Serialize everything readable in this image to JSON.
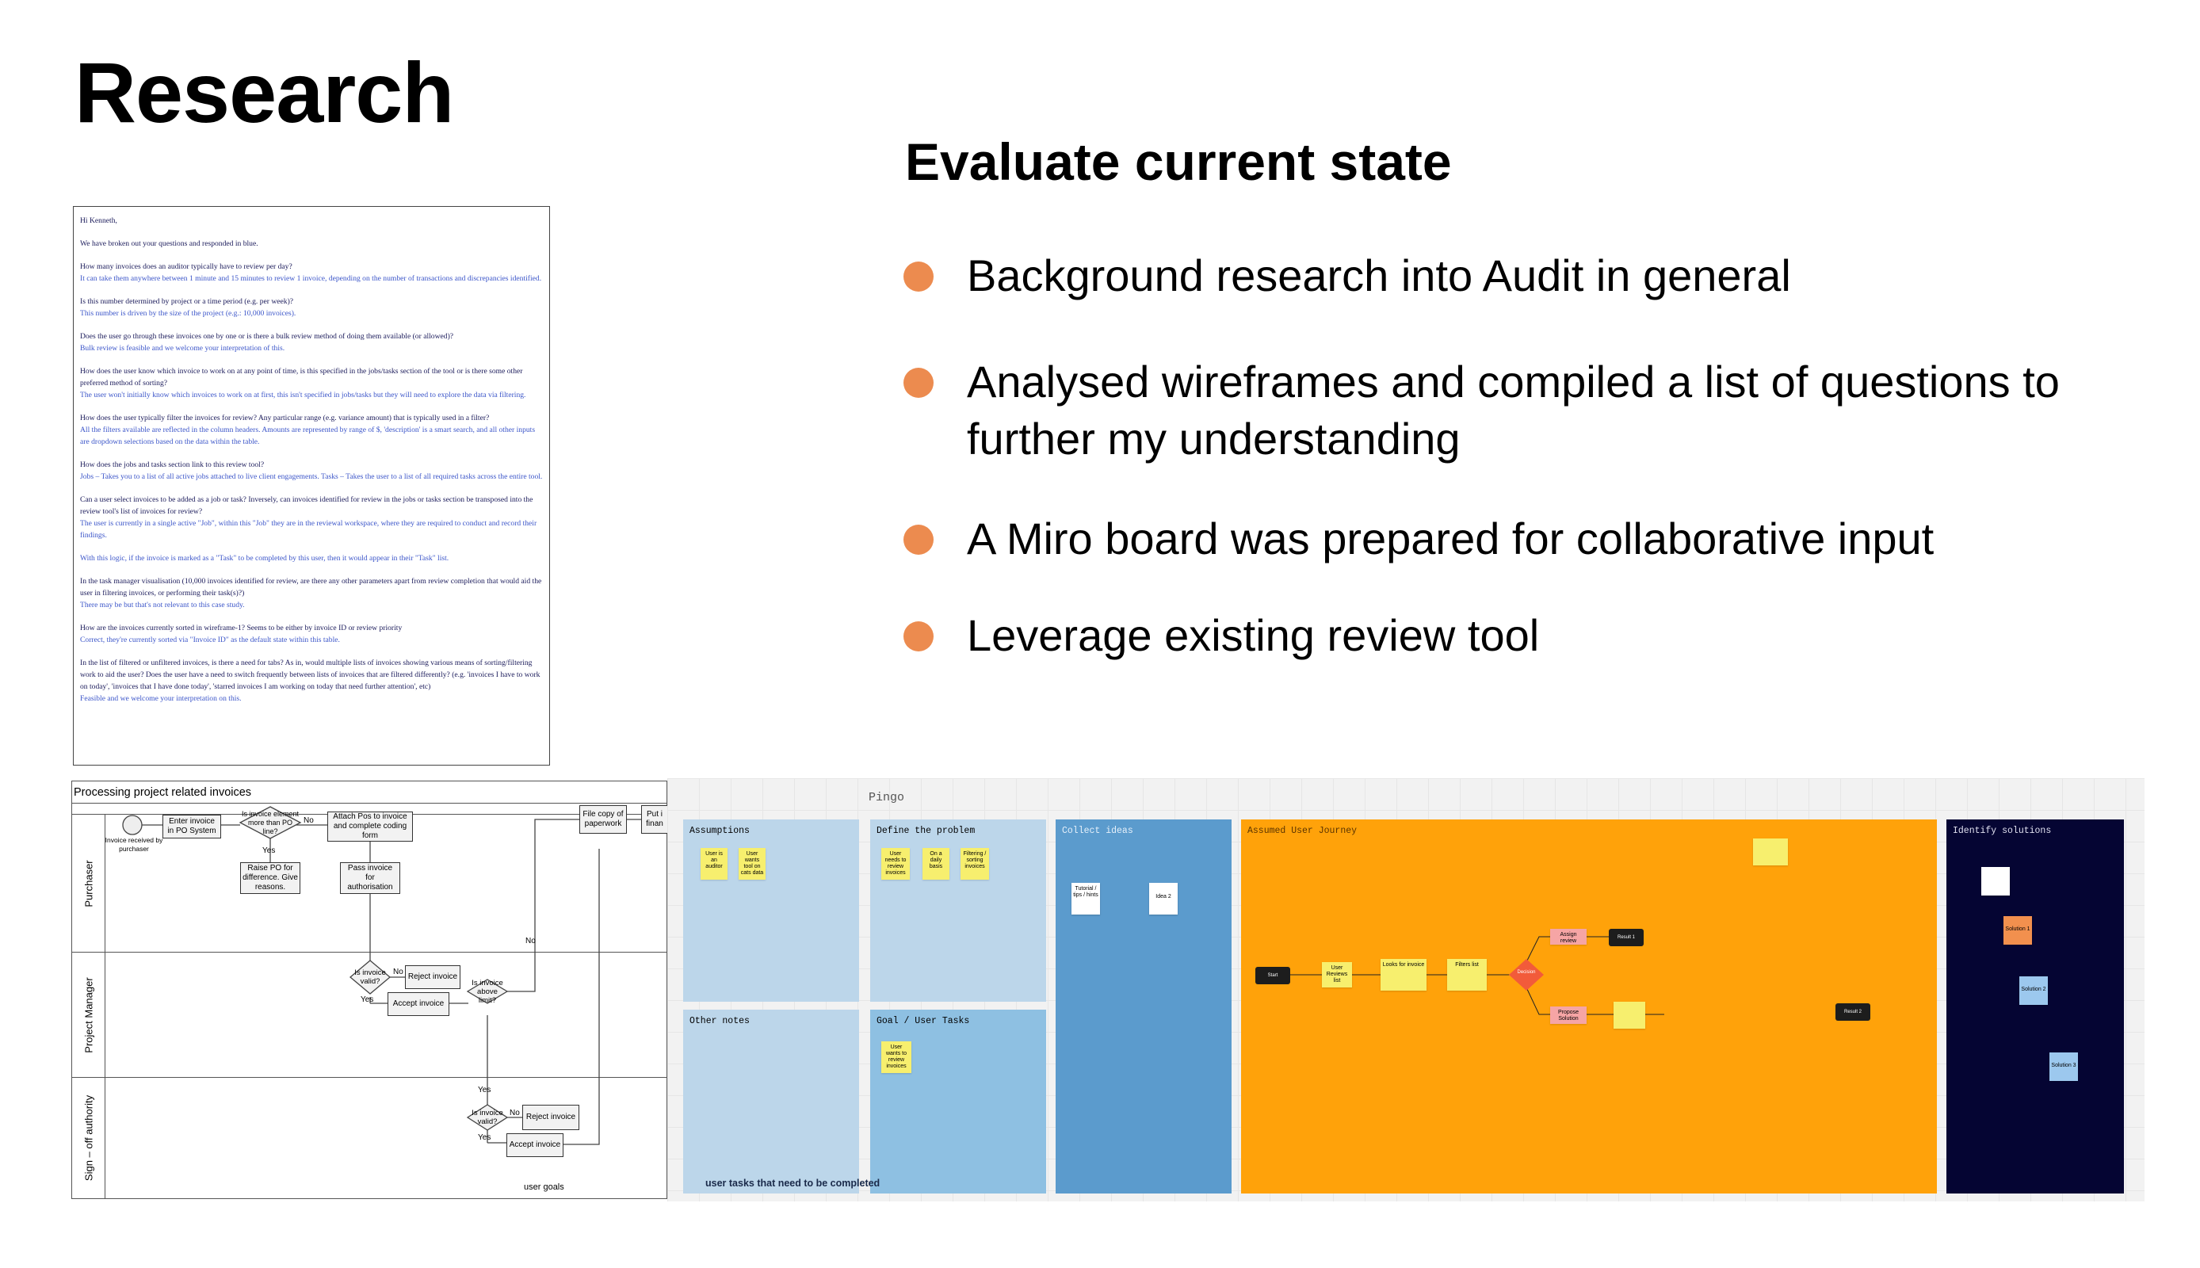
{
  "title": "Research",
  "subtitle": "Evaluate current state",
  "bullets": [
    "Background research into Audit in general",
    "Analysed wireframes and compiled a list of questions to further my understanding",
    "A Miro board was prepared for collaborative input",
    "Leverage existing review tool"
  ],
  "email": {
    "greeting": "Hi Kenneth,",
    "intro": "We have broken out your questions and responded in blue.",
    "qa": [
      {
        "q": "How many invoices does an auditor typically have to review per day?",
        "a": "It can take them anywhere between 1 minute and 15 minutes to review 1 invoice, depending on the number of transactions and discrepancies identified."
      },
      {
        "q": "Is this number determined by project or a time period (e.g. per week)?",
        "a": "This number is driven by the size of the project (e.g.: 10,000 invoices)."
      },
      {
        "q": "Does the user go through these invoices one by one or is there a bulk review method of doing them available (or allowed)?",
        "a": "Bulk review is feasible and we welcome your interpretation of this."
      },
      {
        "q": "How does the user know which invoice to work on at any point of time, is this specified in the jobs/tasks section of the tool or is there some other preferred method of sorting?",
        "a": "The user won't initially know which invoices to work on at first, this isn't specified in jobs/tasks but they will need to explore the data via filtering."
      },
      {
        "q": "How does the user typically filter the invoices for review? Any particular range (e.g. variance amount) that is typically used in a filter?",
        "a": "All the filters available are reflected in the column headers. Amounts are represented by range of $, 'description' is a smart search, and all other inputs are dropdown selections based on the data within the table."
      },
      {
        "q": "How does the jobs and tasks section link to this review tool?",
        "a": "Jobs – Takes you to a list of all active jobs attached to live client engagements. Tasks – Takes the user to a list of all required tasks across the entire tool."
      },
      {
        "q": "Can a user select invoices to be added as a job or task? Inversely, can invoices identified for review in the jobs or tasks section be transposed into the review tool's list of invoices for review?",
        "a": "The user is currently in a single active \"Job\", within this \"Job\" they are in the reviewal workspace, where they are required to conduct and record their findings."
      },
      {
        "q": "",
        "a": "With this logic, if the invoice is marked as a \"Task\" to be completed by this user, then it would appear in their \"Task\" list."
      },
      {
        "q": "In the task manager visualisation (10,000 invoices identified for review, are there any other parameters apart from review completion that would aid the user in filtering invoices, or performing their task(s)?)",
        "a": "There may be but that's not relevant to this case study."
      },
      {
        "q": "How are the invoices currently sorted in wireframe-1? Seems to be either by invoice ID or review priority",
        "a": "Correct, they're currently sorted via \"Invoice ID\" as the default state within this table."
      },
      {
        "q": "In the list of filtered or unfiltered invoices, is there a need for tabs? As in, would multiple lists of invoices showing various means of sorting/filtering work to aid the user? Does the user have a need to switch frequently between lists of invoices that are filtered differently? (e.g. 'invoices I have to work on today', 'invoices that I have done today', 'starred invoices I am working on today that need further attention', etc)",
        "a": "Feasible and we welcome your interpretation on this."
      }
    ]
  },
  "flowchart": {
    "title": "Processing project related invoices",
    "lanes": [
      "Purchaser",
      "Project Manager",
      "Sign – off authority"
    ],
    "nodes": {
      "received": "Invoice received by purchaser",
      "enter": "Enter invoice in PO System",
      "diamond1": "Is invoice element more than PO line?",
      "attach": "Attach Pos to invoice and complete coding form",
      "filecopy": "File copy of paperwork",
      "putinto": "Put i finan",
      "raise": "Raise PO for difference. Give reasons.",
      "pass": "Pass invoice for authorisation",
      "valid1": "Is invoice valid?",
      "reject1": "Reject invoice",
      "accept1": "Accept invoice",
      "above": "Is invoice above limit?",
      "valid2": "Is invoice valid?",
      "reject2": "Reject invoice",
      "accept2": "Accept invoice"
    },
    "labels": {
      "yes": "Yes",
      "no": "No"
    },
    "caption": "user goals"
  },
  "miro": {
    "board_name": "Pingo",
    "frames": {
      "assumptions": "Assumptions",
      "define": "Define the problem",
      "other": "Other notes",
      "goal": "Goal / User Tasks",
      "collect": "Collect ideas",
      "journey": "Assumed User Journey",
      "solutions": "Identify solutions"
    },
    "caption": "user tasks that need to be completed",
    "colors": {
      "light_blue": "#bcd6ea",
      "mid_blue": "#8ec0e2",
      "blue": "#5b9bcd",
      "orange": "#ffa20a",
      "navy": "#050533",
      "sticky_yellow": "#f7ef6e"
    },
    "stickies": {
      "assumptions": [
        "User is an auditor",
        "User wants tool on cats data"
      ],
      "define": [
        "User needs to review invoices",
        "On a daily basis",
        "Filtering / sorting invoices"
      ],
      "goal": [
        "User wants to review invoices"
      ],
      "collect": [
        "Tutorial / tips / hints",
        "Idea 2"
      ],
      "journey": [
        "Start",
        "User Reviews list",
        "Looks for invoice",
        "Filters list",
        "Decision",
        "Assign review",
        "Result 1",
        "Propose Solution",
        "Result 2"
      ],
      "solutions": [
        "Solution 1",
        "Solution 2",
        "Solution 3"
      ]
    }
  },
  "icons": {
    "bullet": "orange-bullet-dot"
  }
}
